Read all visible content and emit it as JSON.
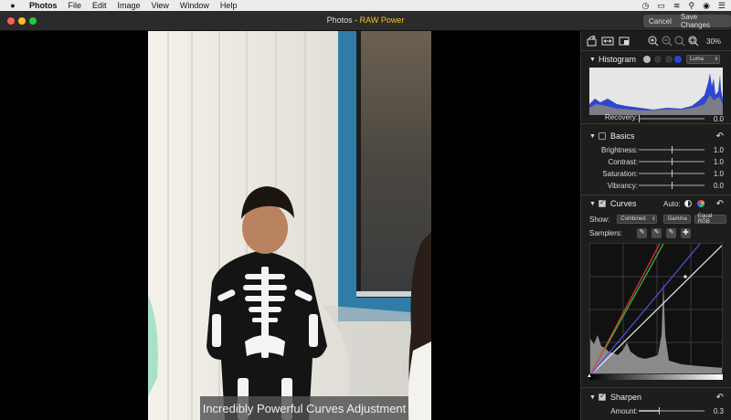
{
  "menubar": {
    "app": "Photos",
    "items": [
      "File",
      "Edit",
      "Image",
      "View",
      "Window",
      "Help"
    ]
  },
  "window": {
    "title_prefix": "Photos - ",
    "title_accent": "RAW Power",
    "cancel_label": "Cancel",
    "save_label": "Save Changes"
  },
  "caption": "Incredibly Powerful Curves Adjustment",
  "toolbar": {
    "zoom": "30%"
  },
  "histogram": {
    "title": "Histogram",
    "channel": "Luma"
  },
  "recovery": {
    "label": "Recovery:",
    "value": "0.0"
  },
  "basics": {
    "title": "Basics",
    "sliders": [
      {
        "label": "Brightness:",
        "value": "1.0",
        "level": 0.5
      },
      {
        "label": "Contrast:",
        "value": "1.0",
        "level": 0.5
      },
      {
        "label": "Saturation:",
        "value": "1.0",
        "level": 0.5
      },
      {
        "label": "Vibrancy:",
        "value": "0.0",
        "level": 0.5
      }
    ]
  },
  "curves": {
    "title": "Curves",
    "auto_label": "Auto:",
    "show_label": "Show:",
    "show_value": "Combined",
    "gamma_label": "Gamma",
    "equal_label": "Equal RGB",
    "samplers_label": "Samplers:"
  },
  "sharpen": {
    "title": "Sharpen",
    "amount_label": "Amount:",
    "amount_value": "0.3",
    "level": 0.3
  },
  "colors": {
    "accent": "#f0c330",
    "hist_blue": "#2448d8",
    "curve_red": "#e23a3a",
    "curve_green": "#38c33a",
    "curve_blue": "#4b54e8"
  }
}
